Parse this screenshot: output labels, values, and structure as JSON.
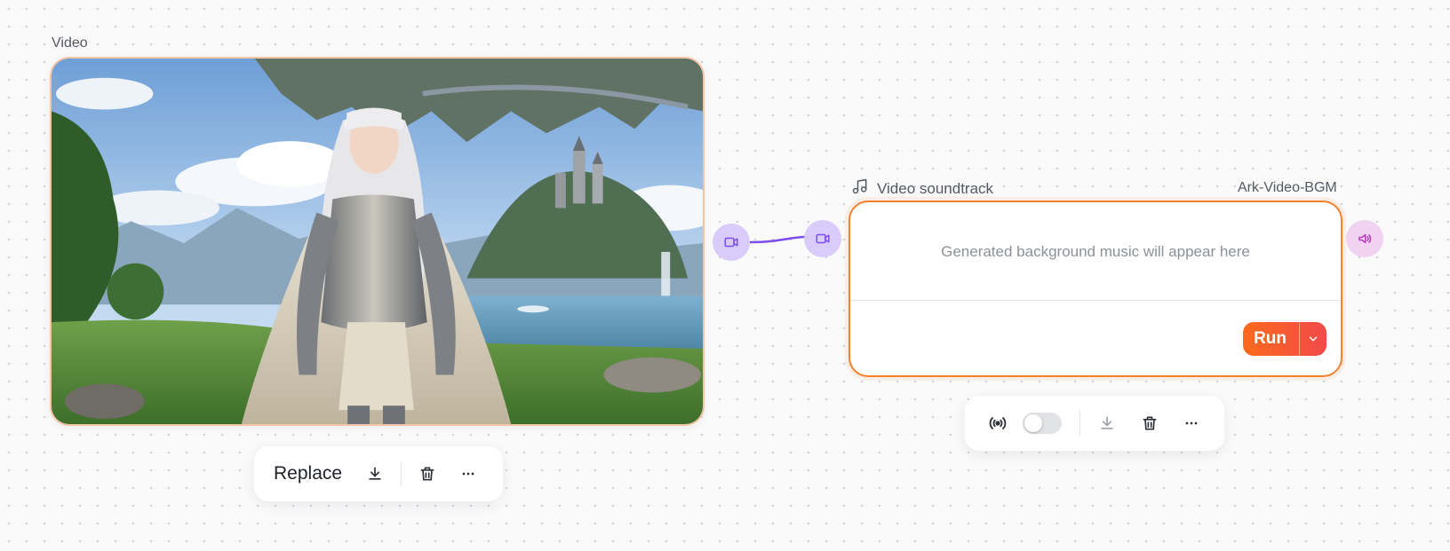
{
  "video_node": {
    "label": "Video",
    "toolbar": {
      "replace_label": "Replace"
    }
  },
  "soundtrack_node": {
    "title": "Video soundtrack",
    "model": "Ark-Video-BGM",
    "placeholder": "Generated background music will appear here",
    "run_label": "Run",
    "toolbar": {
      "auto_toggle_on": false
    }
  },
  "colors": {
    "accent_orange": "#f4812c",
    "run_gradient_start": "#fb6a1c",
    "run_gradient_end": "#f24a4a",
    "port_purple": "#d9ccfb",
    "port_pink": "#f2d2f1",
    "edge_purple": "#7b4cf0"
  },
  "icons": {
    "video_port": "video-camera-icon",
    "audio_port": "speaker-icon",
    "header": "music-note-icon",
    "download": "download-icon",
    "delete": "trash-icon",
    "more": "more-horizontal-icon",
    "broadcast": "broadcast-icon",
    "caret": "chevron-down-icon"
  }
}
